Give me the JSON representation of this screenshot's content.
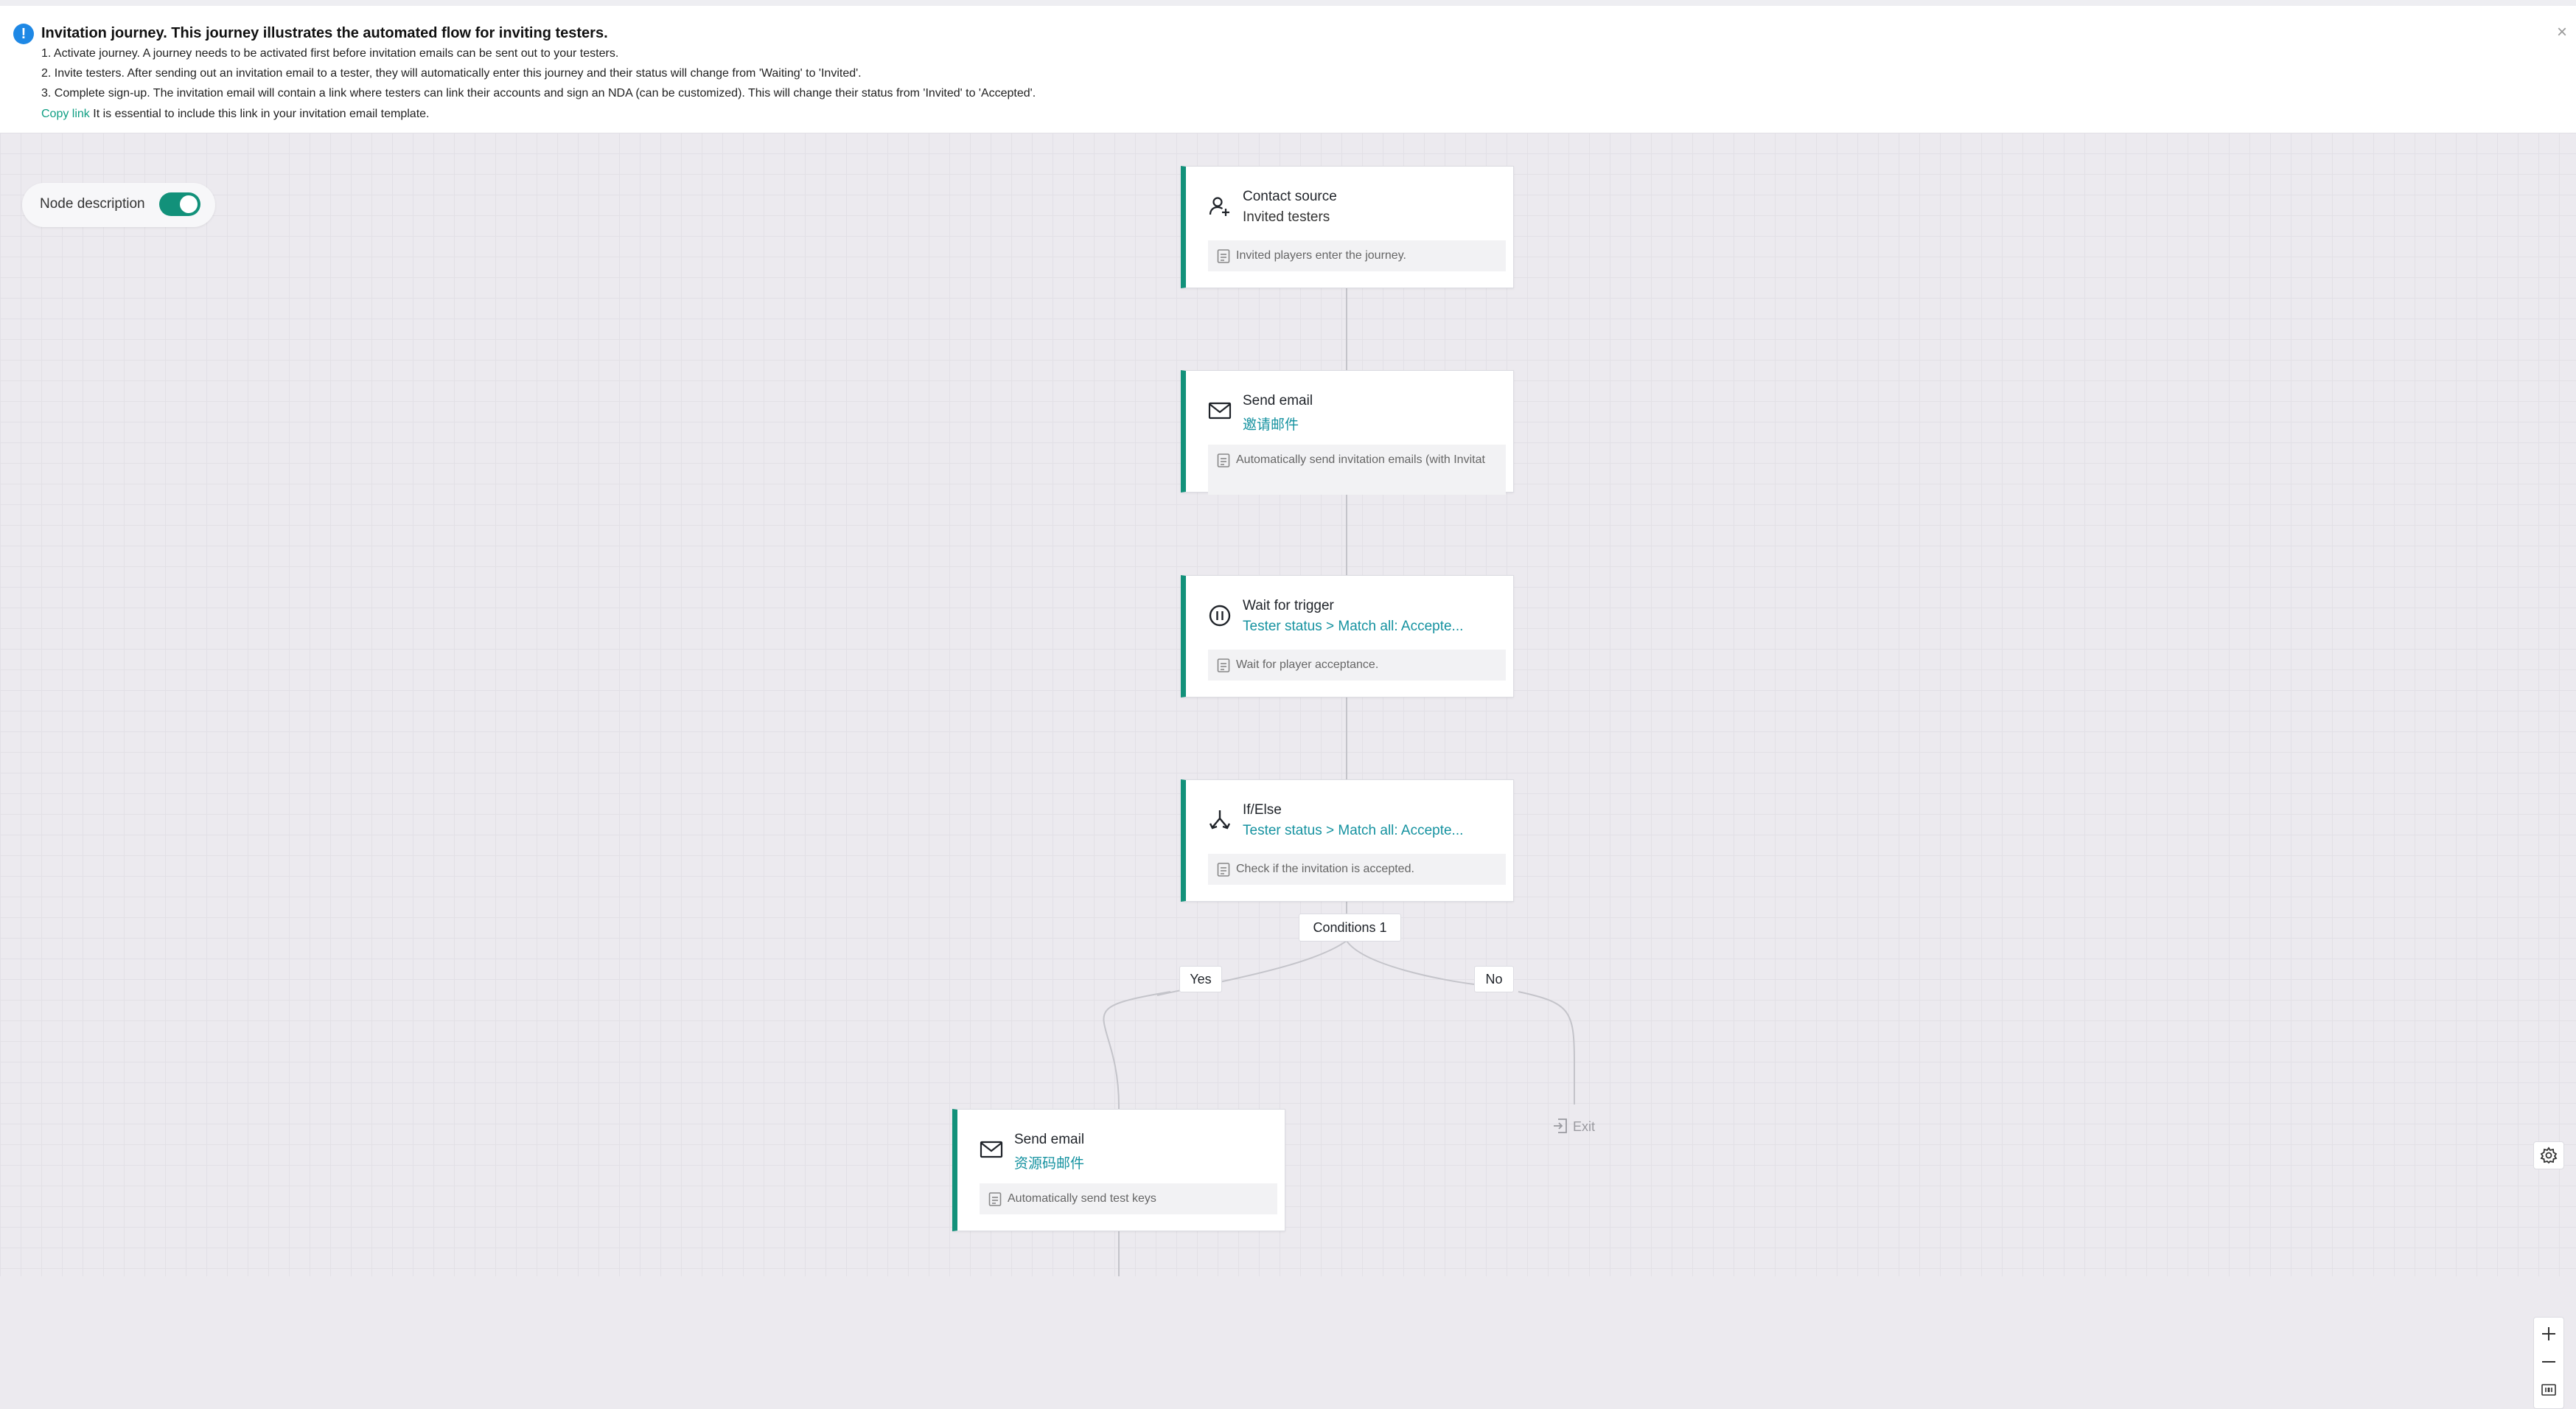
{
  "banner": {
    "title": "Invitation journey. This journey illustrates the automated flow for inviting testers.",
    "lines": [
      "1. Activate journey. A journey needs to be activated first before invitation emails can be sent out to your testers.",
      "2. Invite testers. After sending out an invitation email to a tester, they will automatically enter this journey and their status will change from 'Waiting' to 'Invited'.",
      "3. Complete sign-up. The invitation email will contain a link where testers can link their accounts and sign an NDA (can be customized). This will change their status from 'Invited' to 'Accepted'."
    ],
    "copy_link_label": "Copy link",
    "copy_link_note": " It is essential to include this link in your invitation email template.",
    "close_symbol": "×"
  },
  "toggle": {
    "label": "Node description",
    "enabled": true
  },
  "nodes": [
    {
      "title": "Contact source",
      "subtitle": "Invited testers",
      "description": "Invited players enter the journey.",
      "icon": "user-add-icon"
    },
    {
      "title": "Send email",
      "subtitle": "邀请邮件",
      "description": "Automatically send invitation emails (with Invitat",
      "icon": "mail-icon"
    },
    {
      "title": "Wait for trigger",
      "subtitle": "Tester status > Match all: Accepte...",
      "description": "Wait for player acceptance.",
      "icon": "pause-circle-icon"
    },
    {
      "title": "If/Else",
      "subtitle": "Tester status > Match all: Accepte...",
      "description": "Check if the invitation is accepted.",
      "icon": "branch-icon"
    },
    {
      "title": "Send email",
      "subtitle": "资源码邮件",
      "description": "Automatically send test keys",
      "icon": "mail-icon"
    }
  ],
  "branch": {
    "conditions_label": "Conditions 1",
    "yes_label": "Yes",
    "no_label": "No",
    "exit_label": "Exit"
  },
  "colors": {
    "accent": "#12917a",
    "link": "#0f9e83",
    "info": "#1e88e5",
    "subtitle_accent": "#1592a0"
  }
}
